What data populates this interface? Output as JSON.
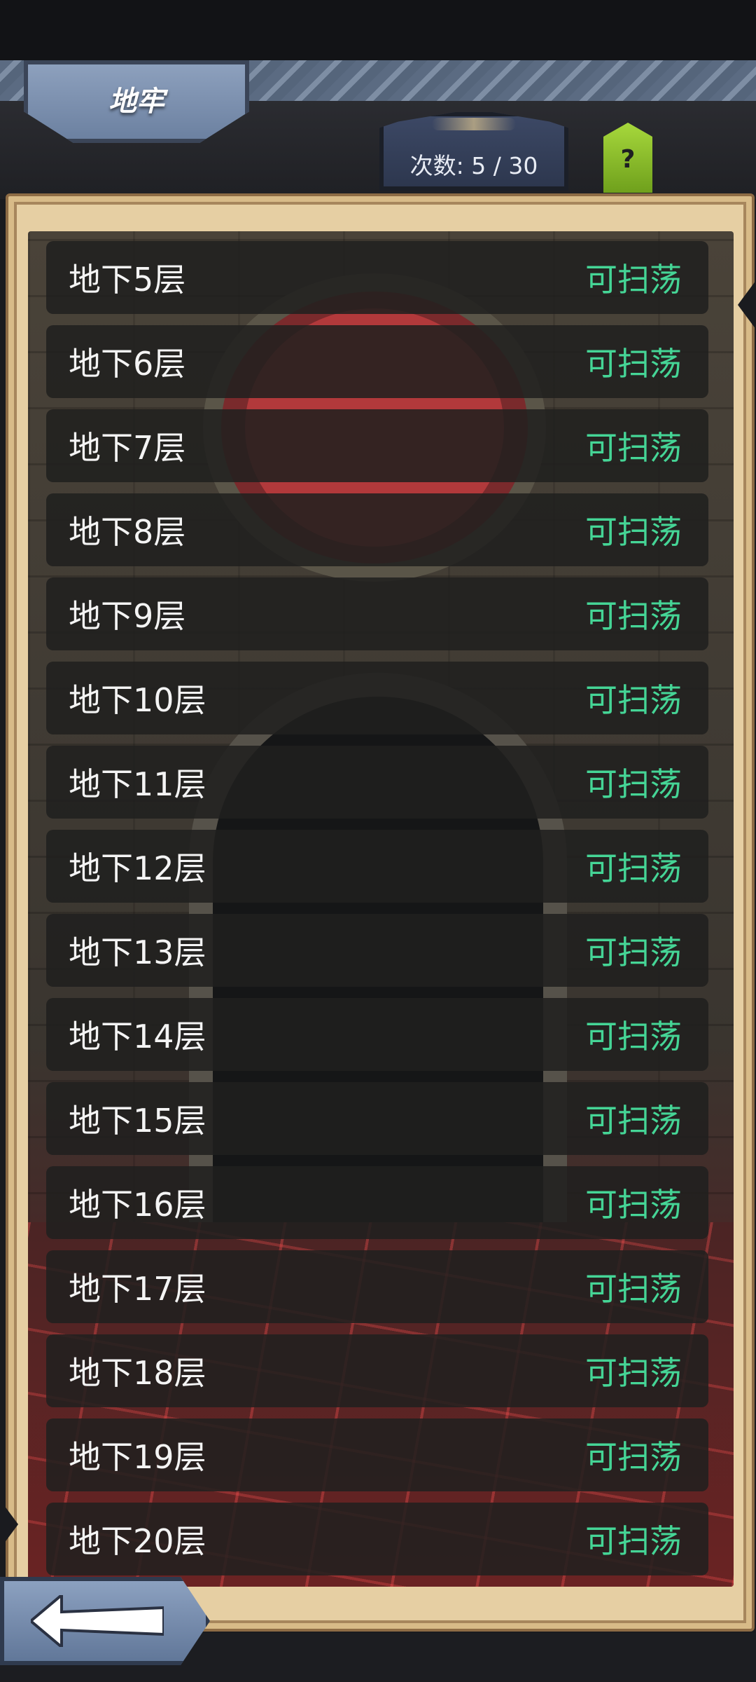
{
  "header": {
    "title": "地牢",
    "attempts": "次数: 5 / 30",
    "help_label": "?"
  },
  "floors": [
    {
      "name": "地下5层",
      "status": "可扫荡"
    },
    {
      "name": "地下6层",
      "status": "可扫荡"
    },
    {
      "name": "地下7层",
      "status": "可扫荡"
    },
    {
      "name": "地下8层",
      "status": "可扫荡"
    },
    {
      "name": "地下9层",
      "status": "可扫荡"
    },
    {
      "name": "地下10层",
      "status": "可扫荡"
    },
    {
      "name": "地下11层",
      "status": "可扫荡"
    },
    {
      "name": "地下12层",
      "status": "可扫荡"
    },
    {
      "name": "地下13层",
      "status": "可扫荡"
    },
    {
      "name": "地下14层",
      "status": "可扫荡"
    },
    {
      "name": "地下15层",
      "status": "可扫荡"
    },
    {
      "name": "地下16层",
      "status": "可扫荡"
    },
    {
      "name": "地下17层",
      "status": "可扫荡"
    },
    {
      "name": "地下18层",
      "status": "可扫荡"
    },
    {
      "name": "地下19层",
      "status": "可扫荡"
    },
    {
      "name": "地下20层",
      "status": "可扫荡"
    }
  ],
  "footer": {
    "back_icon": "back-arrow-icon"
  },
  "colors": {
    "status_green": "#45d596",
    "row_bg": "#201f1e",
    "frame": "#e6cfa3"
  }
}
